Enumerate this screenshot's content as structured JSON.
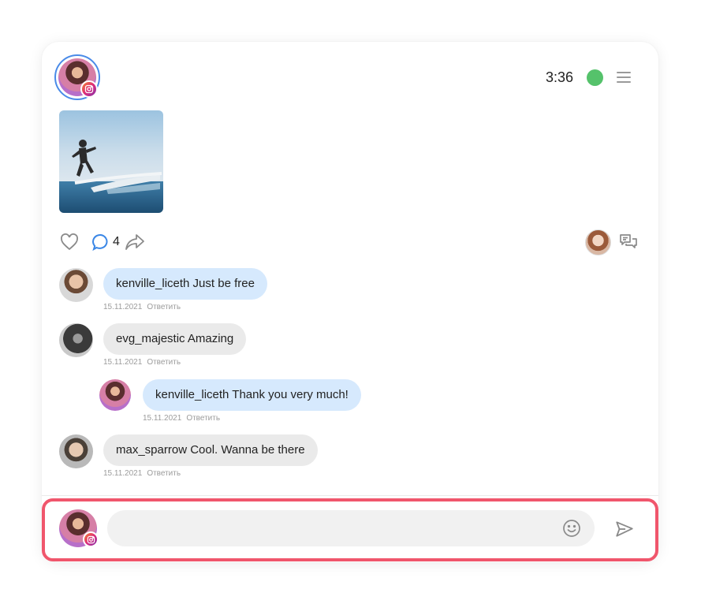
{
  "header": {
    "time": "3:36",
    "status_color": "#55c26b",
    "menu_icon": "hamburger-icon",
    "profile_ring_color": "#4a8be8",
    "profile_badge_icon": "instagram-icon"
  },
  "post": {
    "image_icon": "surfer-photo",
    "comment_count": "4",
    "actions": [
      "heart-icon",
      "comment-icon",
      "share-icon"
    ],
    "right_icons": [
      "viewer-avatar",
      "chats-icon"
    ]
  },
  "comments": [
    {
      "user": "kenville_liceth",
      "text": "Just be free",
      "bubble": "kenville_liceth Just be free",
      "date": "15.11.2021",
      "reply": "Ответить",
      "style": "blue"
    },
    {
      "user": "evg_majestic",
      "text": "Amazing",
      "bubble": "evg_majestic Amazing",
      "date": "15.11.2021",
      "reply": "Ответить",
      "style": "gray"
    },
    {
      "user": "kenville_liceth",
      "text": "Thank you very much!",
      "bubble": "kenville_liceth Thank you very much!",
      "date": "15.11.2021",
      "reply": "Ответить",
      "style": "blue"
    },
    {
      "user": "max_sparrow",
      "text": "Cool. Wanna be there",
      "bubble": "max_sparrow Cool. Wanna be there",
      "date": "15.11.2021",
      "reply": "Ответить",
      "style": "gray"
    }
  ],
  "composer": {
    "value": "",
    "placeholder": "",
    "highlight_color": "#f0566c",
    "icons": [
      "emoji-icon",
      "send-icon"
    ]
  },
  "colors": {
    "bubble_blue": "#d6e9fd",
    "bubble_gray": "#eaeaea",
    "accent": "#4a8be8"
  }
}
